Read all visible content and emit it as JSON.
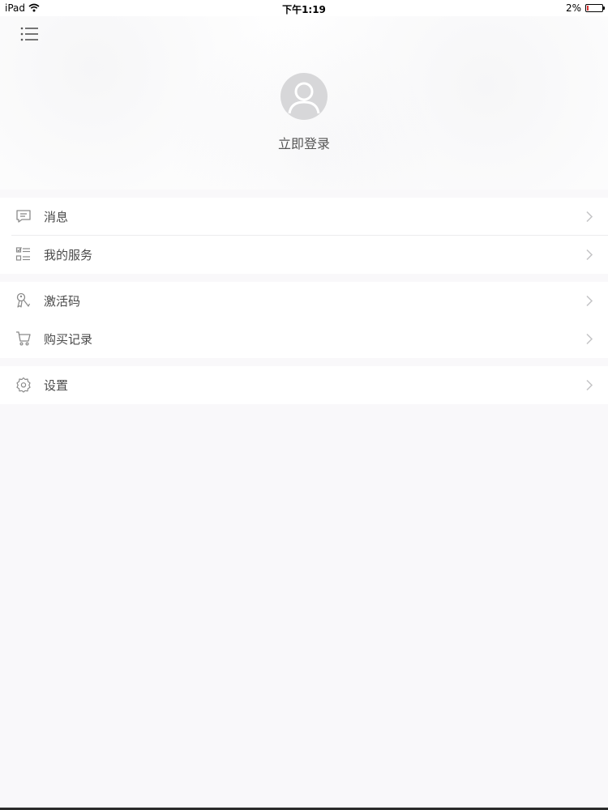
{
  "status_bar": {
    "carrier": "iPad",
    "time": "下午1:19",
    "battery": "2%",
    "battery_level": 0.02
  },
  "header": {
    "menu_icon": "list-menu-icon",
    "avatar_icon": "user-avatar-icon",
    "login_label": "立即登录"
  },
  "menu": {
    "groups": [
      {
        "items": [
          {
            "label": "消息",
            "icon": "message-icon"
          },
          {
            "label": "我的服务",
            "icon": "service-list-icon"
          }
        ]
      },
      {
        "items": [
          {
            "label": "激活码",
            "icon": "key-icon"
          },
          {
            "label": "购买记录",
            "icon": "cart-icon"
          }
        ]
      },
      {
        "items": [
          {
            "label": "设置",
            "icon": "gear-icon"
          }
        ]
      }
    ]
  },
  "colors": {
    "background": "#f9f8fa",
    "card": "#ffffff",
    "icon_gray": "#8a8a8a",
    "chevron": "#c4c4c6",
    "avatar_bg": "#d7d7d9"
  }
}
